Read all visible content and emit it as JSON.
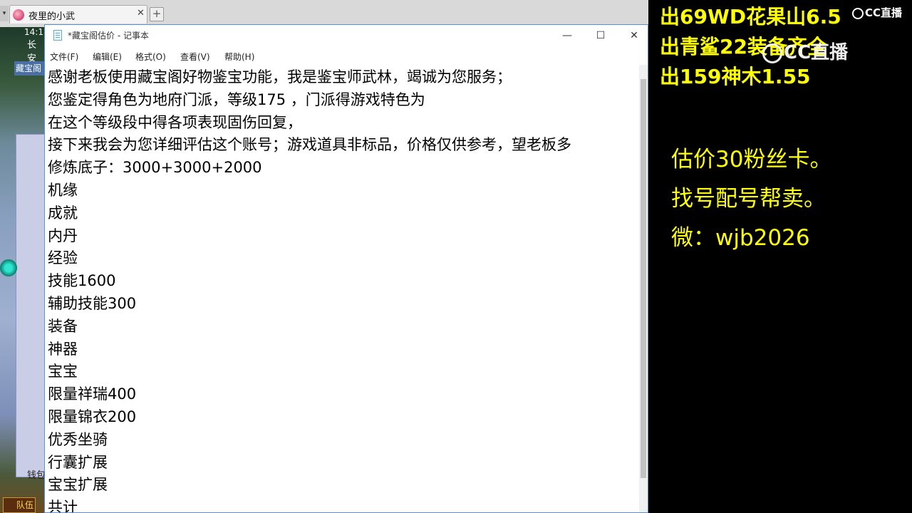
{
  "game": {
    "tab_title": "夜里的小武",
    "tab_close": "✕",
    "new_tab": "+",
    "time": "14:1",
    "location": "长安",
    "cangbao_label": "藏宝阁",
    "money_label": "钱包",
    "team_label": "队伍"
  },
  "notepad": {
    "title": "*藏宝阁估价 - 记事本",
    "window_controls": {
      "minimize": "—",
      "maximize": "☐",
      "close": "✕"
    },
    "menu": [
      {
        "label": "文件(F)"
      },
      {
        "label": "编辑(E)"
      },
      {
        "label": "格式(O)"
      },
      {
        "label": "查看(V)"
      },
      {
        "label": "帮助(H)"
      }
    ],
    "lines": [
      "感谢老板使用藏宝阁好物鉴宝功能，我是鉴宝师武林，竭诚为您服务；",
      "您鉴定得角色为地府门派，等级175 ，门派得游戏特色为",
      "在这个等级段中得各项表现固伤回复，",
      "接下来我会为您详细评估这个账号；游戏道具非标品，价格仅供参考，望老板多",
      "修炼底子：3000+3000+2000",
      "机缘",
      "成就",
      "内丹",
      "经验",
      "技能1600",
      "辅助技能300",
      "装备",
      "神器",
      "宝宝",
      "限量祥瑞400",
      "限量锦衣200",
      "优秀坐骑",
      "行囊扩展",
      "宝宝扩展",
      "共计"
    ]
  },
  "overlay": {
    "sale_lines": [
      "出69WD花果山6.5",
      "出青鲨22装备齐全",
      "出159神木1.55"
    ],
    "cc_logo_text": "CC直播",
    "price_note": "估价30粉丝卡。",
    "service_note": "找号配号帮卖。",
    "wechat_note": "微：wjb2026",
    "text_color": "#ffff00"
  }
}
